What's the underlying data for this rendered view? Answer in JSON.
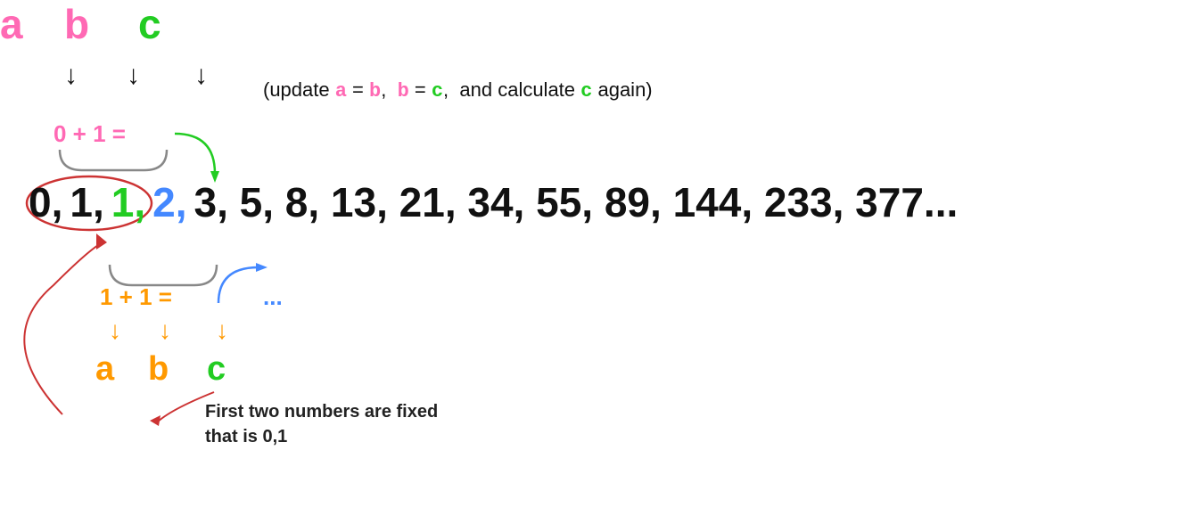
{
  "labels": {
    "a_top": "a",
    "b_top": "b",
    "c_top": "c",
    "a_bottom": "a",
    "b_bottom": "b",
    "c_bottom": "c"
  },
  "update_text": "(update a = b,  b = c,  and calculate c again)",
  "sum_top": "0 + 1 =",
  "sum_bottom": "1 + 1 =",
  "dots": "...",
  "fib_sequence": "0, 1, 1, 2, 3, 5, 8, 13, 21, 34, 55, 89, 144, 233, 377...",
  "annotation_line1": "First two numbers are fixed",
  "annotation_line2": "that is 0,1",
  "colors": {
    "pink": "#ff69b4",
    "green": "#22cc22",
    "blue": "#4488ff",
    "orange": "#ff9900",
    "black": "#111111",
    "red": "#cc2222",
    "gray": "#888888"
  }
}
